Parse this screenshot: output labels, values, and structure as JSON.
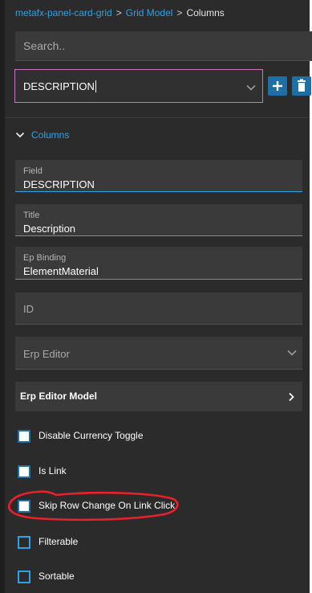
{
  "breadcrumb": {
    "items": [
      "metafx-panel-card-grid",
      "Grid Model",
      "Columns"
    ],
    "separator": ">"
  },
  "search": {
    "placeholder": "Search..",
    "value": ""
  },
  "column_selector": {
    "selected": "DESCRIPTION",
    "add_icon": "plus-icon",
    "delete_icon": "trash-icon"
  },
  "section": {
    "title": "Columns",
    "expanded": true
  },
  "fields": {
    "field": {
      "label": "Field",
      "value": "DESCRIPTION"
    },
    "title": {
      "label": "Title",
      "value": "Description"
    },
    "ep_binding": {
      "label": "Ep Binding",
      "value": "ElementMaterial"
    },
    "id": {
      "label": "ID",
      "value": ""
    },
    "erp_editor": {
      "label": "Erp Editor",
      "value": ""
    }
  },
  "erp_editor_model": {
    "label": "Erp Editor Model"
  },
  "checkboxes": [
    {
      "label": "Disable Currency Toggle",
      "checked": false
    },
    {
      "label": "Is Link",
      "checked": false
    },
    {
      "label": "Skip Row Change On Link Click",
      "checked": false
    },
    {
      "label": "Filterable",
      "checked": true
    },
    {
      "label": "Sortable",
      "checked": true
    }
  ],
  "colors": {
    "panel_bg": "#2b2b2b",
    "field_bg": "#3a3a3a",
    "accent": "#2ea2e6",
    "button": "#1d6fa5",
    "focus_border": "#c975bd",
    "annotation": "#e8212a"
  }
}
